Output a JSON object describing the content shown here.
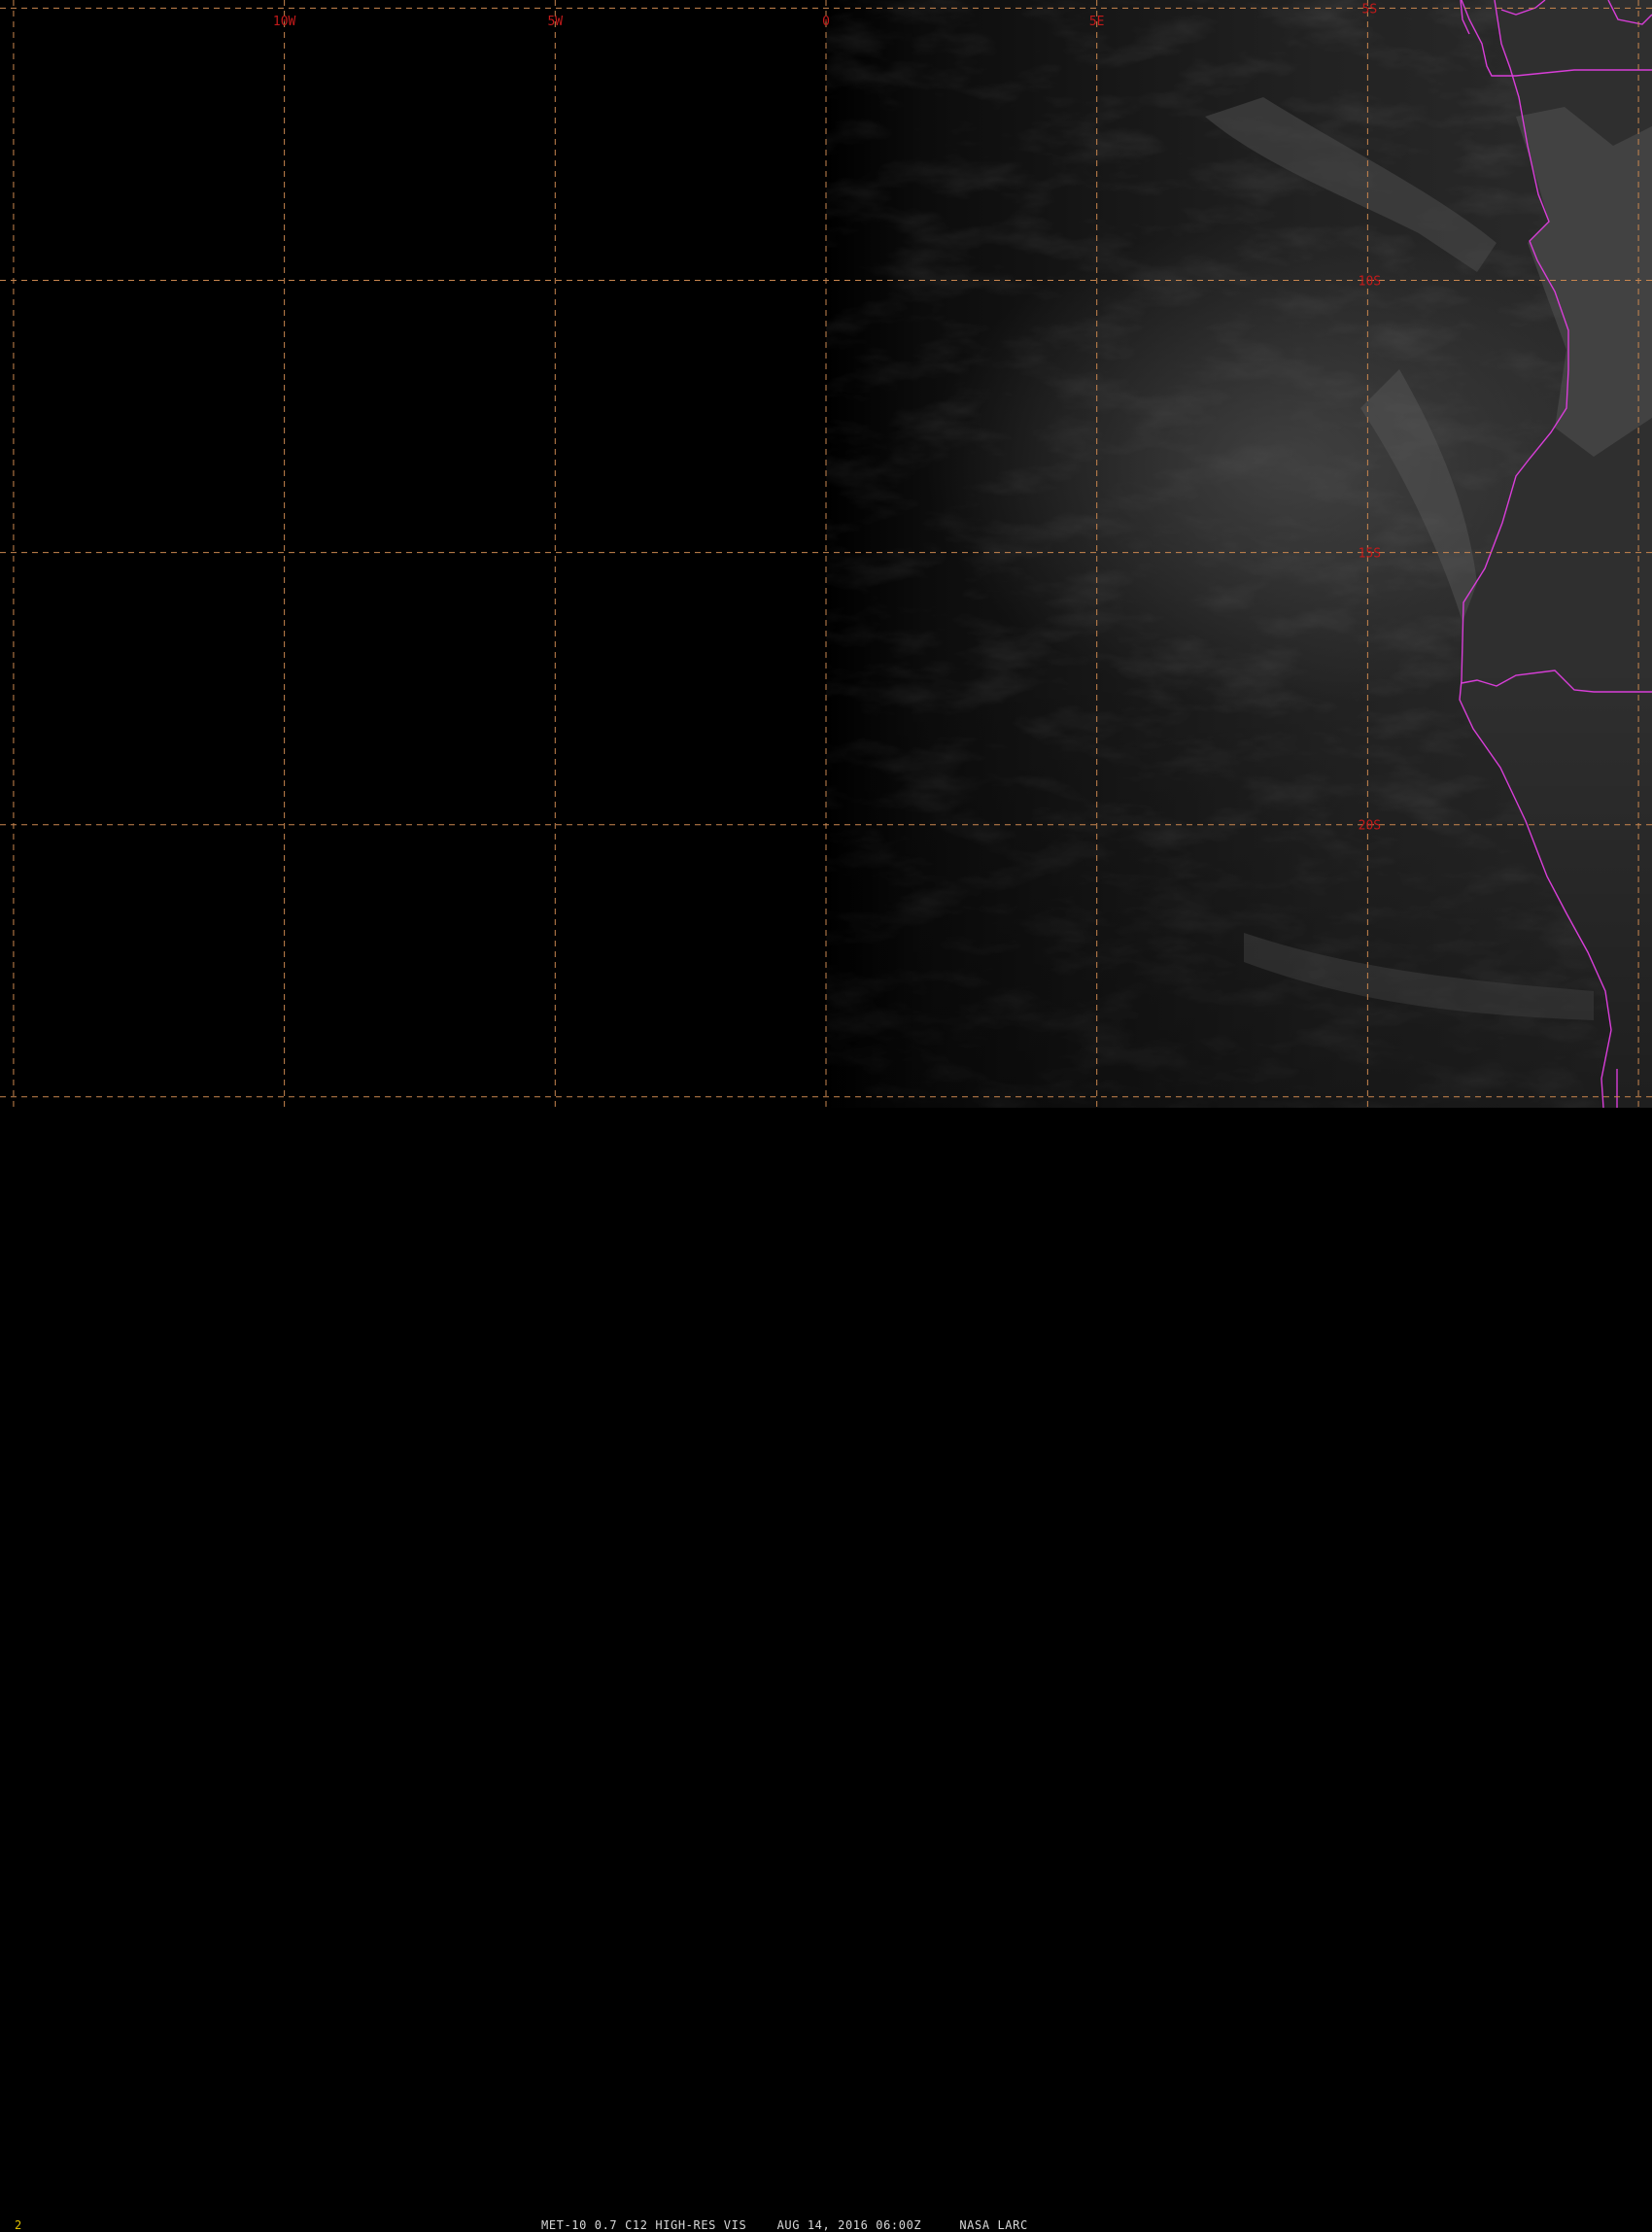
{
  "colors": {
    "background": "#000000",
    "grid_line": "#c9864f",
    "grid_label": "#c41a1a",
    "boundary": "#d83ed8",
    "frame_number": "#e0c000",
    "status_text": "#d8d8d8"
  },
  "map": {
    "projection": "satellite visible",
    "lon_range": [
      -15.25,
      15.25
    ],
    "lat_range": [
      -25.2,
      -4.85
    ],
    "grid_lon": [
      -15,
      -10,
      -5,
      0,
      5,
      10,
      15
    ],
    "grid_lat": [
      -5,
      -10,
      -15,
      -20,
      -25
    ],
    "lon_labels": [
      {
        "lon": -10,
        "text": "10W"
      },
      {
        "lon": -5,
        "text": "5W"
      },
      {
        "lon": 0,
        "text": "0"
      },
      {
        "lon": 5,
        "text": "5E"
      }
    ],
    "lat_labels": [
      {
        "lat": -5,
        "text": "5S"
      },
      {
        "lat": -10,
        "text": "10S"
      },
      {
        "lat": -15,
        "text": "15S"
      },
      {
        "lat": -20,
        "text": "20S"
      }
    ]
  },
  "footer": {
    "frame_number": "2",
    "status": "MET-10 0.7 C12 HIGH-RES VIS    AUG 14, 2016 06:00Z     NASA LARC"
  }
}
